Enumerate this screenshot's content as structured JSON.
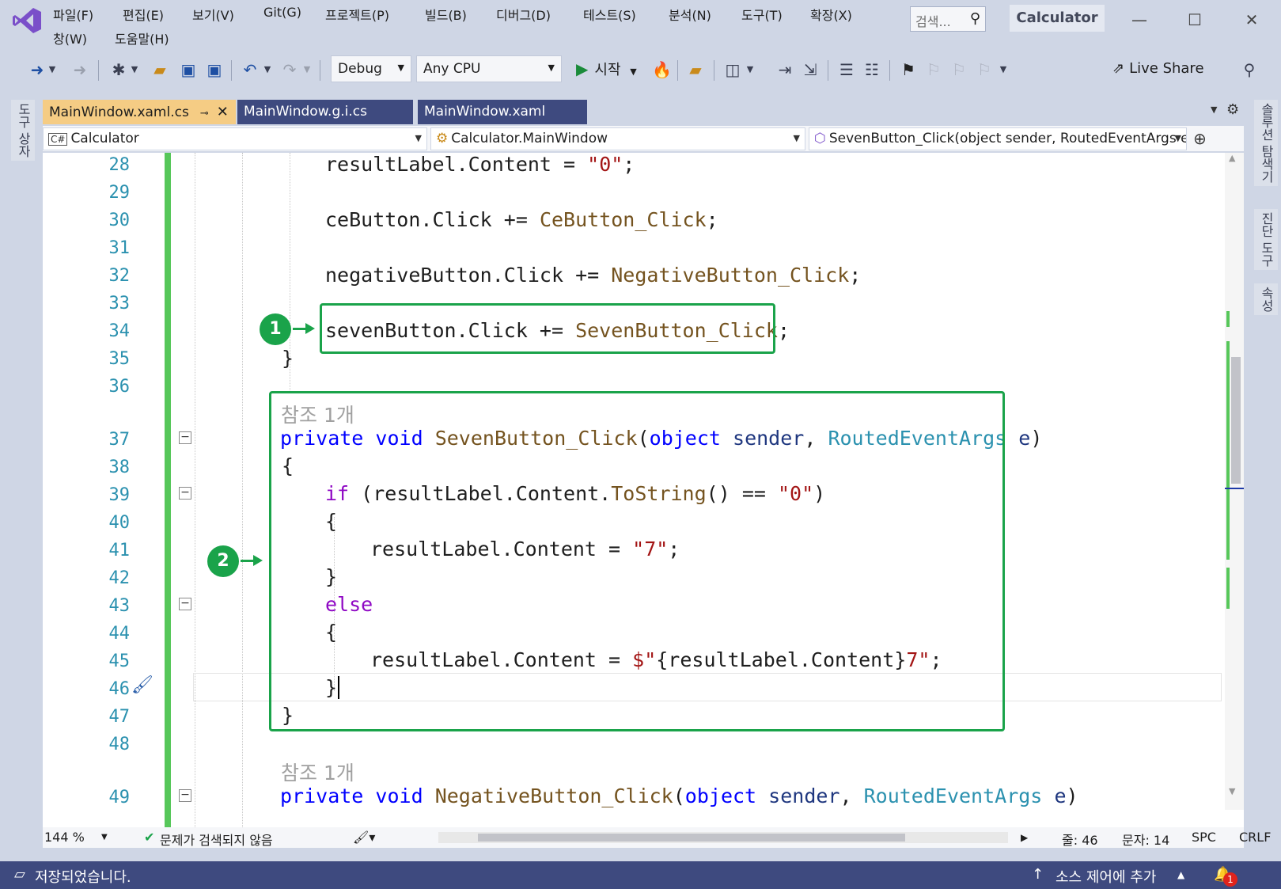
{
  "menu": {
    "items": [
      "파일(F)",
      "편집(E)",
      "보기(V)",
      "Git(G)",
      "프로젝트(P)",
      "빌드(B)",
      "디버그(D)",
      "테스트(S)",
      "분석(N)",
      "도구(T)",
      "확장(X)"
    ],
    "items_row2": [
      "창(W)",
      "도움말(H)"
    ],
    "search_placeholder": "검색...",
    "solution_name": "Calculator"
  },
  "toolbar": {
    "config": "Debug",
    "platform": "Any CPU",
    "start_label": "시작",
    "live_share": "Live Share"
  },
  "left_rail": {
    "toolbox": "도구 상자"
  },
  "right_rail": {
    "solution_explorer": "솔루션 탐색기",
    "diagnostics": "진단 도구",
    "properties": "속성"
  },
  "tabs": [
    {
      "label": "MainWindow.xaml.cs"
    },
    {
      "label": "MainWindow.g.i.cs"
    },
    {
      "label": "MainWindow.xaml"
    }
  ],
  "navbar": {
    "project": "Calculator",
    "class": "Calculator.MainWindow",
    "member": "SevenButton_Click(object sender, RoutedEventArgs e)"
  },
  "code": {
    "line_numbers": [
      "28",
      "29",
      "30",
      "31",
      "32",
      "33",
      "34",
      "35",
      "36",
      "37",
      "38",
      "39",
      "40",
      "41",
      "42",
      "43",
      "44",
      "45",
      "46",
      "47",
      "48",
      "49"
    ],
    "ref_label": "참조 1개",
    "l28": {
      "id": "resultLabel.Content = ",
      "str": "\"0\"",
      "end": ";"
    },
    "l30": {
      "id": "ceButton.Click += ",
      "method": "CeButton_Click",
      "end": ";"
    },
    "l32": {
      "id": "negativeButton.Click += ",
      "method": "NegativeButton_Click",
      "end": ";"
    },
    "l34": {
      "id": "sevenButton.Click += ",
      "method": "SevenButton_Click",
      "end": ";"
    },
    "l35": "}",
    "l37": {
      "kw1": "private",
      "kw2": "void",
      "method": "SevenButton_Click",
      "open": "(",
      "kw3": "object",
      "p1": "sender",
      "comma": ", ",
      "type": "RoutedEventArgs",
      "p2": "e",
      "close": ")"
    },
    "l38": "{",
    "l39": {
      "kw": "if",
      "mid": " (resultLabel.Content.",
      "method": "ToString",
      "rest": "() == ",
      "str": "\"0\"",
      "close": ")"
    },
    "l40": "{",
    "l41": {
      "id": "resultLabel.Content = ",
      "str": "\"7\"",
      "end": ";"
    },
    "l42": "}",
    "l43": "else",
    "l44": "{",
    "l45": {
      "id": "resultLabel.Content = ",
      "str1": "$\"",
      "interp": "{resultLabel.Content}",
      "str2": "7\"",
      "end": ";"
    },
    "l46": "}",
    "l47": "}",
    "l49": {
      "kw1": "private",
      "kw2": "void",
      "method": "NegativeButton_Click",
      "open": "(",
      "kw3": "object",
      "p1": "sender",
      "comma": ", ",
      "type": "RoutedEventArgs",
      "p2": "e",
      "close": ")"
    }
  },
  "annotations": {
    "marker1": "1",
    "marker2": "2"
  },
  "editor_status": {
    "zoom": "144 %",
    "issues": "문제가 검색되지 않음",
    "line": "줄: 46",
    "char": "문자: 14",
    "spc": "SPC",
    "crlf": "CRLF"
  },
  "statusbar": {
    "message": "저장되었습니다.",
    "source_control": "소스 제어에 추가",
    "notification_count": "1"
  },
  "colors": {
    "accent_green": "#1aa34a",
    "keyword": "#0000ff",
    "control_keyword": "#8f08c4",
    "string": "#a31515",
    "method": "#74531f",
    "type": "#2b91af",
    "statusbar": "#3e4a7f"
  }
}
